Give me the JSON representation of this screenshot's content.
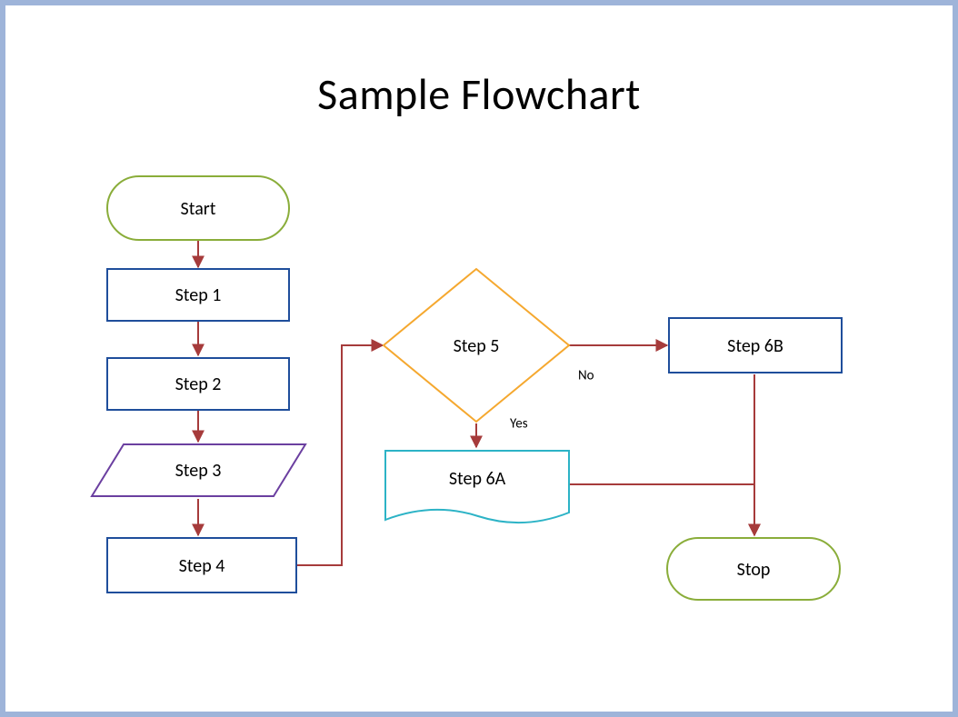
{
  "title": "Sample Flowchart",
  "nodes": {
    "start": {
      "label": "Start"
    },
    "step1": {
      "label": "Step 1"
    },
    "step2": {
      "label": "Step 2"
    },
    "step3": {
      "label": "Step 3"
    },
    "step4": {
      "label": "Step 4"
    },
    "step5": {
      "label": "Step 5"
    },
    "step6a": {
      "label": "Step 6A"
    },
    "step6b": {
      "label": "Step 6B"
    },
    "stop": {
      "label": "Stop"
    }
  },
  "edgeLabels": {
    "yes": "Yes",
    "no": "No"
  },
  "colors": {
    "border": "#9eb4d9",
    "rectStroke": "#1f4e9b",
    "terminator": "#8aad3a",
    "decision": "#f5a82f",
    "dataStroke": "#6b3fa0",
    "docStroke": "#2cb3c6",
    "connector": "#a63b3b"
  }
}
